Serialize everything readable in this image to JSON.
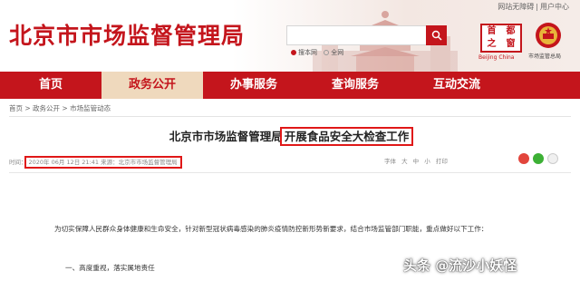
{
  "header": {
    "site_title": "北京市市场监督管理局",
    "top_links": [
      "网站无障碍",
      "用户中心"
    ],
    "search": {
      "placeholder": "",
      "button_icon": "search-icon"
    },
    "search_scope": [
      "搜本网",
      "全网"
    ],
    "capital_logo": {
      "chars": [
        "之",
        "首",
        "窗",
        "都"
      ],
      "caption": "Beijing China"
    },
    "emblem_caption": "市场监管总局"
  },
  "nav": {
    "items": [
      {
        "label": "首页",
        "active": false
      },
      {
        "label": "政务公开",
        "active": true
      },
      {
        "label": "办事服务",
        "active": false
      },
      {
        "label": "查询服务",
        "active": false
      },
      {
        "label": "互动交流",
        "active": false
      }
    ]
  },
  "breadcrumb": {
    "text": "首页 > 政务公开 > 市场监管动态"
  },
  "article": {
    "title_prefix": "北京市市场监督管理局",
    "title_highlight": "开展食品安全大检查工作",
    "meta_label": "时间：",
    "meta_info": "2020年 06月 12日 21:41 来源：北京市市场监督管理局",
    "tools": [
      "字体",
      "大",
      "中",
      "小",
      "打印"
    ],
    "share_icons": [
      "weibo-icon",
      "wechat-icon",
      "more-icon"
    ],
    "paragraph": "为切实保障人民群众身体健康和生命安全，针对新型冠状病毒感染的肺炎疫情防控新形势新要求，结合市场监管部门职能，重点做好以下工作：",
    "section_1": "一、高度重视，落实属地责任"
  },
  "watermark": "头条 @流沙小妖怪",
  "colors": {
    "brand_red": "#c4151c",
    "nav_active_bg": "#efd9bd",
    "highlight_box": "#e01818"
  }
}
